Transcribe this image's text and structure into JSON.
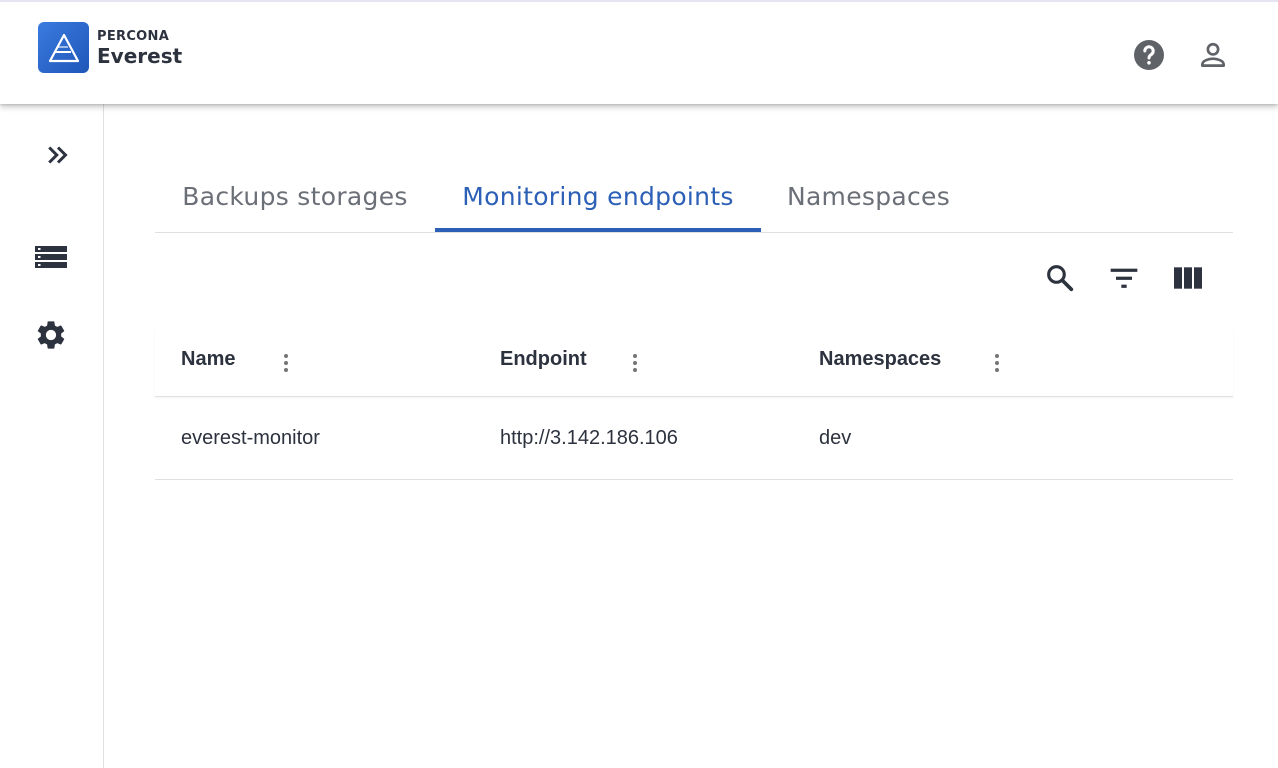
{
  "brand": {
    "top": "PERCONA",
    "bottom": "Everest",
    "accent": "#2c5fb6"
  },
  "header": {
    "icons": [
      "help-icon",
      "user-icon"
    ]
  },
  "sidebar": {
    "icons": [
      "expand-icon",
      "databases-icon",
      "settings-icon"
    ]
  },
  "tabs": [
    {
      "label": "Backups storages",
      "active": false
    },
    {
      "label": "Monitoring endpoints",
      "active": true
    },
    {
      "label": "Namespaces",
      "active": false
    }
  ],
  "toolbar": {
    "icons": [
      "search-icon",
      "filter-icon",
      "columns-icon"
    ]
  },
  "table": {
    "columns": [
      "Name",
      "Endpoint",
      "Namespaces"
    ],
    "rows": [
      {
        "name": "everest-monitor",
        "endpoint": "http://3.142.186.106",
        "namespaces": "dev"
      }
    ]
  }
}
